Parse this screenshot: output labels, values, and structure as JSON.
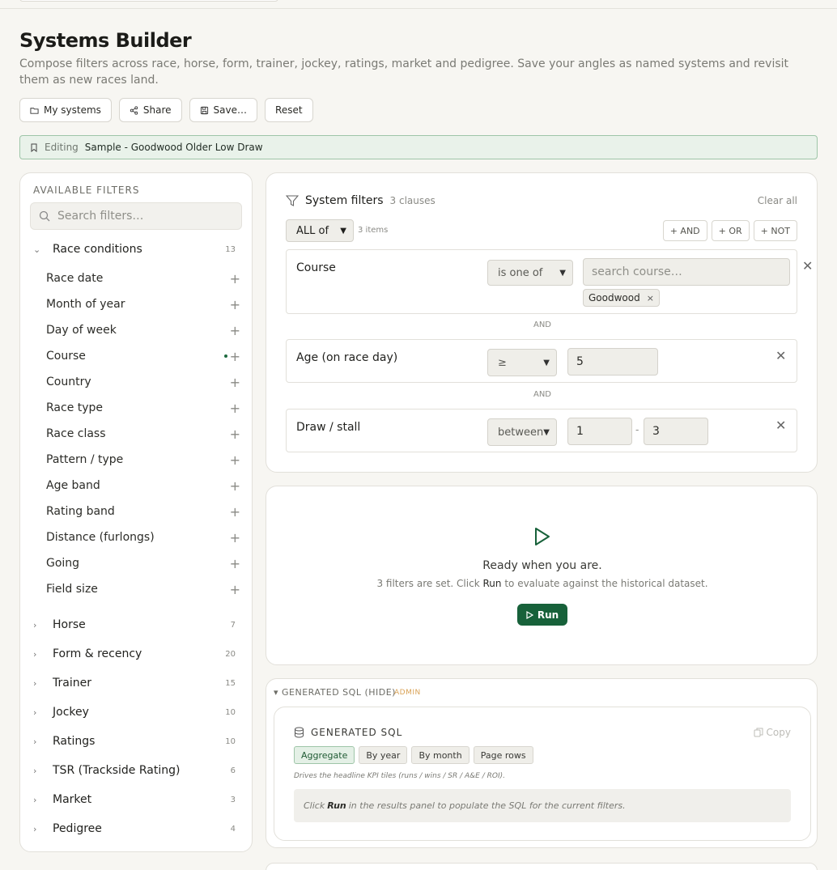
{
  "page": {
    "title": "Systems Builder",
    "subtitle": "Compose filters across race, horse, form, trainer, jockey, ratings, market and pedigree. Save your angles as named systems and revisit them as new races land."
  },
  "toolbar": {
    "my_systems": "My systems",
    "share": "Share",
    "save": "Save…",
    "reset": "Reset"
  },
  "editing": {
    "label": "Editing",
    "value": "Sample - Goodwood Older Low Draw"
  },
  "sidebar": {
    "title": "AVAILABLE FILTERS",
    "search_placeholder": "Search filters…",
    "expanded_group": {
      "name": "Race conditions",
      "count": "13"
    },
    "race_conditions_items": [
      "Race date",
      "Month of year",
      "Day of week",
      "Course",
      "Country",
      "Race type",
      "Race class",
      "Pattern / type",
      "Age band",
      "Rating band",
      "Distance (furlongs)",
      "Going",
      "Field size"
    ],
    "groups": [
      {
        "name": "Horse",
        "count": "7"
      },
      {
        "name": "Form & recency",
        "count": "20"
      },
      {
        "name": "Trainer",
        "count": "15"
      },
      {
        "name": "Jockey",
        "count": "10"
      },
      {
        "name": "Ratings",
        "count": "10"
      },
      {
        "name": "TSR (Trackside Rating)",
        "count": "6"
      },
      {
        "name": "Market",
        "count": "3"
      },
      {
        "name": "Pedigree",
        "count": "4"
      }
    ],
    "plus": "+"
  },
  "filters": {
    "title": "System filters",
    "count": "3 clauses",
    "clear_all": "Clear all",
    "combinator": "ALL of",
    "items_count": "3 items",
    "add_and": "+ AND",
    "add_or": "+ OR",
    "add_not": "+ NOT",
    "separator": "AND",
    "clauses": [
      {
        "name": "Course",
        "operator": "is one of",
        "placeholder": "search course…",
        "chip": "Goodwood"
      },
      {
        "name": "Age (on race day)",
        "operator": "≥",
        "value": "5"
      },
      {
        "name": "Draw / stall",
        "operator": "between",
        "from": "1",
        "dash": "-",
        "to": "3"
      }
    ],
    "remove": "✕",
    "chip_remove": "×"
  },
  "run": {
    "ready": "Ready when you are.",
    "hint_before": "3 filters are set. Click",
    "hint_run": "Run",
    "hint_after": "to evaluate against the historical dataset.",
    "button": "Run"
  },
  "sql": {
    "toggle": "▾ GENERATED SQL (HIDE)",
    "admin": "ADMIN",
    "title": "GENERATED SQL",
    "copy": "Copy",
    "tabs": [
      "Aggregate",
      "By year",
      "By month",
      "Page rows"
    ],
    "active_tab": "Aggregate",
    "description": "Drives the headline KPI tiles (runs / wins / SR / A&E / ROI).",
    "placeholder_before": "Click",
    "placeholder_run": "Run",
    "placeholder_after": "in the results panel to populate the SQL for the current filters."
  },
  "colors": {
    "accent": "#17613a",
    "editing_bg": "#e9f2ea",
    "admin": "#d9a256"
  }
}
